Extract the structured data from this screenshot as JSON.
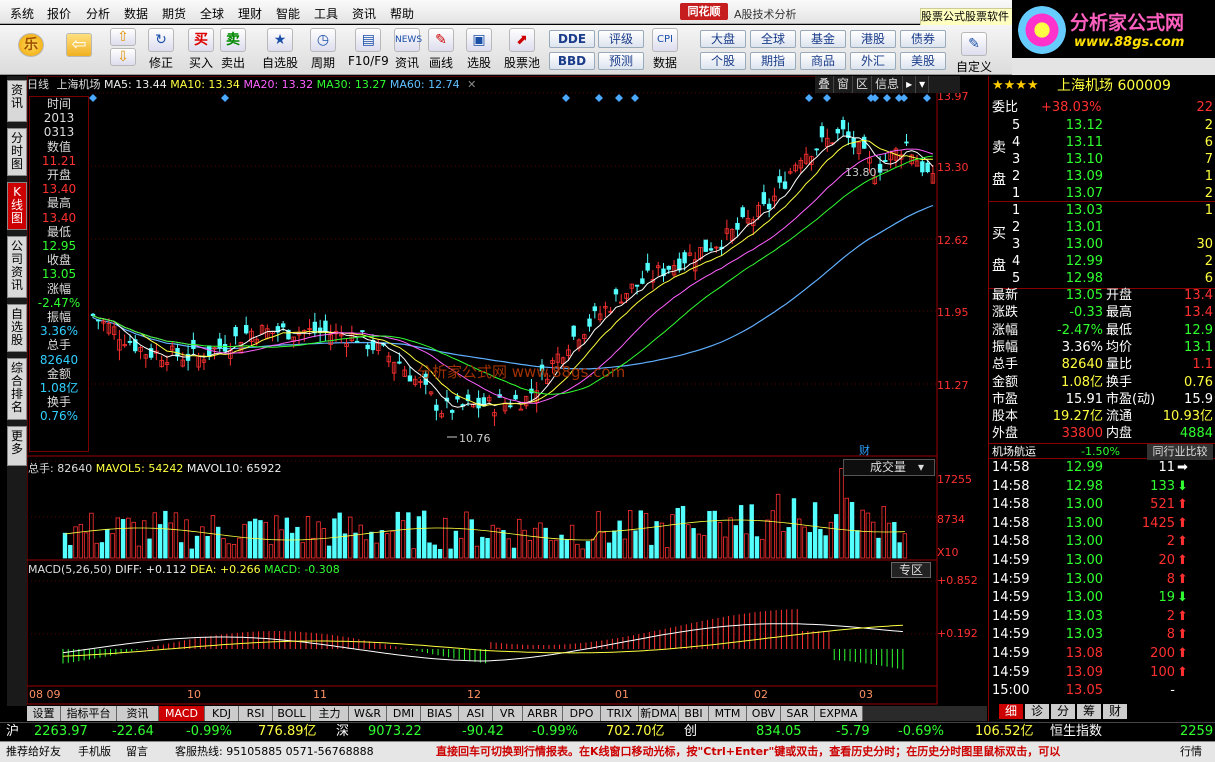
{
  "menu": [
    "系统",
    "报价",
    "分析",
    "数据",
    "期货",
    "全球",
    "理财",
    "智能",
    "工具",
    "资讯",
    "帮助"
  ],
  "brand": {
    "name": "同花顺",
    "subtitle": "A股技术分析"
  },
  "ad": {
    "text": "股票公式股票软件",
    "logo_title": "分析家公式网",
    "logo_url": "www.88gs.com"
  },
  "toolbar": {
    "buttons": [
      {
        "label": "",
        "icon": "home-icon"
      },
      {
        "label": "",
        "icon": "back-arrow-icon"
      },
      {
        "label": "",
        "icon": "up-down-icon"
      },
      {
        "label": "修正",
        "icon": "refresh-icon"
      },
      {
        "label": "买入",
        "icon": "buy-icon",
        "glyph": "买"
      },
      {
        "label": "卖出",
        "icon": "sell-icon",
        "glyph": "卖"
      },
      {
        "label": "自选股",
        "icon": "watchlist-icon"
      },
      {
        "label": "周期",
        "icon": "clock-icon"
      },
      {
        "label": "F10/F9",
        "icon": "f10-icon"
      },
      {
        "label": "资讯",
        "icon": "news-icon"
      },
      {
        "label": "画线",
        "icon": "pen-icon"
      },
      {
        "label": "选股",
        "icon": "select-icon"
      },
      {
        "label": "股票池",
        "icon": "pool-icon"
      },
      {
        "label": "数据",
        "icon": "cpi-icon"
      }
    ],
    "small": [
      "DDE",
      "BBD",
      "评级",
      "预测",
      "大盘",
      "个股",
      "全球",
      "期指",
      "基金",
      "商品",
      "港股",
      "外汇",
      "债券",
      "美股",
      "自定义"
    ]
  },
  "lefttabs": [
    {
      "label": "资讯"
    },
    {
      "label": "分时图"
    },
    {
      "label": "K线图",
      "active": true
    },
    {
      "label": "公司资讯"
    },
    {
      "label": "自选股"
    },
    {
      "label": "综合排名"
    },
    {
      "label": "更多"
    }
  ],
  "main": {
    "period": "日线",
    "name": "上海机场",
    "ma5": "MA5: 13.44",
    "ma10": "MA10: 13.34",
    "ma20": "MA20: 13.32",
    "ma30": "MA30: 13.27",
    "ma60": "MA60: 12.74",
    "topright": [
      "叠",
      "窗",
      "区",
      "信息"
    ],
    "yticks": [
      "13.97",
      "13.30",
      "12.62",
      "11.95",
      "11.27"
    ],
    "high_mark": "13.80",
    "low_mark": "10.76",
    "cai": "财",
    "watermark": "分析家公式网 www.88gs.com"
  },
  "infobox": [
    {
      "k": "时间",
      "v": "2013",
      "v2": "0313"
    },
    {
      "k": "数值",
      "v": "11.21",
      "c": "#ff3030"
    },
    {
      "k": "开盘",
      "v": "13.40",
      "c": "#ff3030"
    },
    {
      "k": "最高",
      "v": "13.40",
      "c": "#ff3030"
    },
    {
      "k": "最低",
      "v": "12.95",
      "c": "#30ff30"
    },
    {
      "k": "收盘",
      "v": "13.05",
      "c": "#30ff30"
    },
    {
      "k": "涨幅",
      "v": "-2.47%",
      "c": "#30ff30"
    },
    {
      "k": "振幅",
      "v": "3.36%",
      "c": "#30d0ff"
    },
    {
      "k": "总手",
      "v": "82640",
      "c": "#30d0ff"
    },
    {
      "k": "金额",
      "v": "1.08亿",
      "c": "#30d0ff"
    },
    {
      "k": "换手",
      "v": "0.76%",
      "c": "#30d0ff"
    }
  ],
  "volume": {
    "head": "总手: 82640",
    "mavol5": "MAVOL5: 54242",
    "mavol10": "MAVOL10: 65922",
    "selector": "成交量",
    "yticks": [
      "17255",
      "8734"
    ],
    "x10": "X10"
  },
  "macd": {
    "head": "MACD(5,26,50)",
    "diff": "DIFF: +0.112",
    "dea": "DEA: +0.266",
    "macd": "MACD: -0.308",
    "zone": "专区",
    "yticks": [
      "+0.852",
      "+0.192"
    ]
  },
  "dates": [
    "08 09",
    "10",
    "11",
    "12",
    "01",
    "02",
    "03"
  ],
  "btabs": [
    "设置",
    "指标平台",
    "资讯",
    "MACD",
    "KDJ",
    "RSI",
    "BOLL",
    "主力",
    "W&R",
    "DMI",
    "BIAS",
    "ASI",
    "VR",
    "ARBR",
    "DPO",
    "TRIX",
    "新DMA",
    "BBI",
    "MTM",
    "OBV",
    "SAR",
    "EXPMA"
  ],
  "quote": {
    "title": "上海机场 600009",
    "stars": "★★★★",
    "weibi": {
      "k": "委比",
      "v": "+38.03%",
      "n": "22"
    },
    "sell": [
      {
        "i": "5",
        "p": "13.12",
        "n": "2"
      },
      {
        "i": "4",
        "p": "13.11",
        "n": "6"
      },
      {
        "i": "3",
        "p": "13.10",
        "n": "7"
      },
      {
        "i": "2",
        "p": "13.09",
        "n": "1"
      },
      {
        "i": "1",
        "p": "13.07",
        "n": "2"
      }
    ],
    "buy": [
      {
        "i": "1",
        "p": "13.03",
        "n": "1"
      },
      {
        "i": "2",
        "p": "13.01",
        "n": ""
      },
      {
        "i": "3",
        "p": "13.00",
        "n": "30"
      },
      {
        "i": "4",
        "p": "12.99",
        "n": "2"
      },
      {
        "i": "5",
        "p": "12.98",
        "n": "6"
      }
    ],
    "sell_label": "卖盘",
    "buy_label": "买盘",
    "stats": [
      {
        "k1": "最新",
        "v1": "13.05",
        "c1": "#30ff30",
        "k2": "开盘",
        "v2": "13.4",
        "c2": "#ff3030"
      },
      {
        "k1": "涨跌",
        "v1": "-0.33",
        "c1": "#30ff30",
        "k2": "最高",
        "v2": "13.4",
        "c2": "#ff3030"
      },
      {
        "k1": "涨幅",
        "v1": "-2.47%",
        "c1": "#30ff30",
        "k2": "最低",
        "v2": "12.9",
        "c2": "#30ff30"
      },
      {
        "k1": "振幅",
        "v1": "3.36%",
        "c1": "#ffffff",
        "k2": "均价",
        "v2": "13.1",
        "c2": "#30ff30"
      },
      {
        "k1": "总手",
        "v1": "82640",
        "c1": "#ffff40",
        "k2": "量比",
        "v2": "1.1",
        "c2": "#ff3030"
      },
      {
        "k1": "金额",
        "v1": "1.08亿",
        "c1": "#ffff40",
        "k2": "换手",
        "v2": "0.76",
        "c2": "#ffff40"
      },
      {
        "k1": "市盈",
        "v1": "15.91",
        "c1": "#ffffff",
        "k2": "市盈(动)",
        "v2": "15.9",
        "c2": "#ffffff"
      },
      {
        "k1": "股本",
        "v1": "19.27亿",
        "c1": "#ffff40",
        "k2": "流通",
        "v2": "10.93亿",
        "c2": "#ffff40"
      },
      {
        "k1": "外盘",
        "v1": "33800",
        "c1": "#ff3030",
        "k2": "内盘",
        "v2": "4884",
        "c2": "#30ff30"
      }
    ],
    "industry": {
      "name": "机场航运",
      "pct": "-1.50%",
      "btn": "同行业比较"
    },
    "ticks": [
      {
        "t": "14:58",
        "p": "12.99",
        "n": "11",
        "d": "w"
      },
      {
        "t": "14:58",
        "p": "12.98",
        "n": "133",
        "d": "d"
      },
      {
        "t": "14:58",
        "p": "13.00",
        "n": "521",
        "d": "u"
      },
      {
        "t": "14:58",
        "p": "13.00",
        "n": "1425",
        "d": "u"
      },
      {
        "t": "14:58",
        "p": "13.00",
        "n": "2",
        "d": "u"
      },
      {
        "t": "14:59",
        "p": "13.00",
        "n": "20",
        "d": "u"
      },
      {
        "t": "14:59",
        "p": "13.00",
        "n": "8",
        "d": "u"
      },
      {
        "t": "14:59",
        "p": "13.00",
        "n": "19",
        "d": "d"
      },
      {
        "t": "14:59",
        "p": "13.03",
        "n": "2",
        "d": "u"
      },
      {
        "t": "14:59",
        "p": "13.03",
        "n": "8",
        "d": "u"
      },
      {
        "t": "14:59",
        "p": "13.08",
        "n": "200",
        "d": "u"
      },
      {
        "t": "14:59",
        "p": "13.09",
        "n": "100",
        "d": "u"
      },
      {
        "t": "15:00",
        "p": "13.05",
        "n": "-",
        "d": "n"
      }
    ],
    "tabs": [
      "细",
      "诊",
      "分",
      "筹",
      "财"
    ]
  },
  "indexbar": {
    "sh": "沪",
    "sh_v": "2263.97",
    "sh_c": "-22.64",
    "sh_p": "-0.99%",
    "sh_a": "776.89亿",
    "sz": "深",
    "sz_v": "9073.22",
    "sz_c": "-90.42",
    "sz_p": "-0.99%",
    "sz_a": "702.70亿",
    "cy": "创",
    "cy_v": "834.05",
    "cy_c": "-5.79",
    "cy_p": "-0.69%",
    "hs_a": "106.52亿",
    "hs": "恒生指数",
    "hs_v": "2259"
  },
  "status": {
    "s1": "推荐给好友",
    "s2": "手机版",
    "s3": "留言",
    "s4": "客服热线: 95105885 0571-56768888",
    "tip": "直接回车可切换到行情报表。在K线窗口移动光标，按\"Ctrl+Enter\"键或双击，查看历史分时；在历史分时图里鼠标双击，可以",
    "s5": "行情"
  }
}
